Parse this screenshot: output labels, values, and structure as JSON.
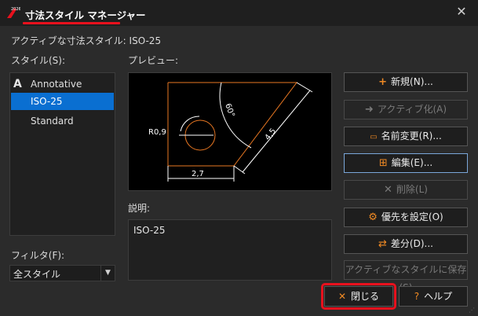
{
  "window": {
    "version_badge": "2026",
    "title": "寸法スタイル マネージャー",
    "close_glyph": "✕"
  },
  "current_style": {
    "label": "アクティブな寸法スタイル:",
    "value": "ISO-25",
    "text": "アクティブな寸法スタイル: ISO-25"
  },
  "styles": {
    "label": "スタイル(S):",
    "items": [
      {
        "label": "Annotative",
        "icon": "annotative-icon",
        "icon_glyph": "A"
      },
      {
        "label": "ISO-25",
        "selected": true
      },
      {
        "label": "Standard"
      }
    ]
  },
  "filter": {
    "label": "フィルタ(F):",
    "value": "全スタイル",
    "arrow": "▼"
  },
  "preview": {
    "label": "プレビュー:",
    "annotations": {
      "radius": "R0,9",
      "angle": "60°",
      "length_diag": "4,5",
      "length_bottom": "2,7"
    },
    "colors": {
      "outline": "#e87722",
      "dims": "#ffffff"
    }
  },
  "description": {
    "label": "説明:",
    "text": "ISO-25"
  },
  "buttons": [
    {
      "label": "新規(N)...",
      "icon": "plus-icon",
      "glyph": "+",
      "disabled": false
    },
    {
      "label": "アクティブ化(A)",
      "icon": "arrow-right-icon",
      "glyph": "➜",
      "disabled": true
    },
    {
      "label": "名前変更(R)...",
      "icon": "rename-icon",
      "glyph": "▭",
      "disabled": false
    },
    {
      "label": "編集(E)...",
      "icon": "edit-dimension-icon",
      "glyph": "⊞",
      "disabled": false,
      "focused": true
    },
    {
      "label": "削除(L)",
      "icon": "delete-icon",
      "glyph": "✕",
      "disabled": true
    },
    {
      "label": "優先を設定(O)",
      "icon": "override-icon",
      "glyph": "⚙",
      "disabled": false
    },
    {
      "label": "差分(D)...",
      "icon": "compare-icon",
      "glyph": "⇄",
      "disabled": false
    },
    {
      "label": "アクティブなスタイルに保存(S)",
      "icon": null,
      "glyph": "",
      "disabled": true
    }
  ],
  "footer": {
    "close_label": "閉じる",
    "close_glyph": "✕",
    "help_label": "ヘルプ",
    "help_glyph": "?"
  },
  "accent": {
    "selection": "#0a6fd1",
    "highlight": "#e8111d",
    "icon_orange": "#f08a24"
  }
}
